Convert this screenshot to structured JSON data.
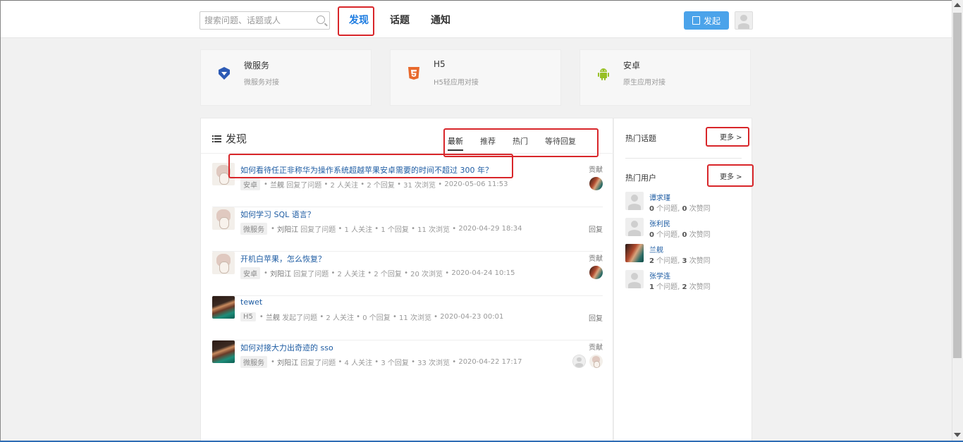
{
  "search": {
    "placeholder": "搜索问题、话题或人"
  },
  "nav": {
    "discover": "发现",
    "topics": "话题",
    "notifications": "通知"
  },
  "header": {
    "launch_label": "发起"
  },
  "categories": [
    {
      "title": "微服务",
      "subtitle": "微服务对接",
      "icon": "shield-diamond-icon",
      "color": "#2d5bb5"
    },
    {
      "title": "H5",
      "subtitle": "H5轻应用对接",
      "icon": "html5-icon",
      "color": "#e8692c"
    },
    {
      "title": "安卓",
      "subtitle": "原生应用对接",
      "icon": "android-icon",
      "color": "#97c024"
    }
  ],
  "main": {
    "title": "发现",
    "tabs": [
      "最新",
      "推荐",
      "热门",
      "等待回复"
    ],
    "questions": [
      {
        "title": "如何看待任正非称华为操作系统超越苹果安卓需要的时间不超过 300 年？",
        "tag": "安卓",
        "user": "兰舰",
        "action": "回复了问题",
        "follows": "2 人关注",
        "replies": "2 个回复",
        "views": "31 次浏览",
        "time": "2020-05-06 11:53",
        "right": "贡献"
      },
      {
        "title": "如何学习 SQL 语言？",
        "tag": "微服务",
        "user": "刘阳江",
        "action": "回复了问题",
        "follows": "1 人关注",
        "replies": "1 个回复",
        "views": "11 次浏览",
        "time": "2020-04-29 18:34",
        "right": "回复"
      },
      {
        "title": "开机白苹果，怎么恢复？",
        "tag": "安卓",
        "user": "刘阳江",
        "action": "回复了问题",
        "follows": "2 人关注",
        "replies": "2 个回复",
        "views": "20 次浏览",
        "time": "2020-04-24 10:15",
        "right": "贡献"
      },
      {
        "title": "tewet",
        "tag": "H5",
        "user": "兰舰",
        "action": "发起了问题",
        "follows": "2 人关注",
        "replies": "0 个回复",
        "views": "11 次浏览",
        "time": "2020-04-23 00:01",
        "right": "回复"
      },
      {
        "title": "如何对接大力出奇迹的 sso",
        "tag": "微服务",
        "user": "刘阳江",
        "action": "回复了问题",
        "follows": "4 人关注",
        "replies": "3 个回复",
        "views": "33 次浏览",
        "time": "2020-04-22 17:17",
        "right": "贡献"
      }
    ]
  },
  "sidebar": {
    "hot_topics": "热门话题",
    "hot_users": "热门用户",
    "more": "更多 >",
    "users": [
      {
        "name": "谭求瑾",
        "q": "0",
        "q_label": "个问题,",
        "l": "0",
        "l_label": "次赞同"
      },
      {
        "name": "张利民",
        "q": "0",
        "q_label": "个问题,",
        "l": "0",
        "l_label": "次赞同"
      },
      {
        "name": "兰舰",
        "q": "2",
        "q_label": "个问题,",
        "l": "3",
        "l_label": "次赞同"
      },
      {
        "name": "张学连",
        "q": "1",
        "q_label": "个问题,",
        "l": "2",
        "l_label": "次赞同"
      }
    ]
  },
  "highlight_color": "#d8262a"
}
